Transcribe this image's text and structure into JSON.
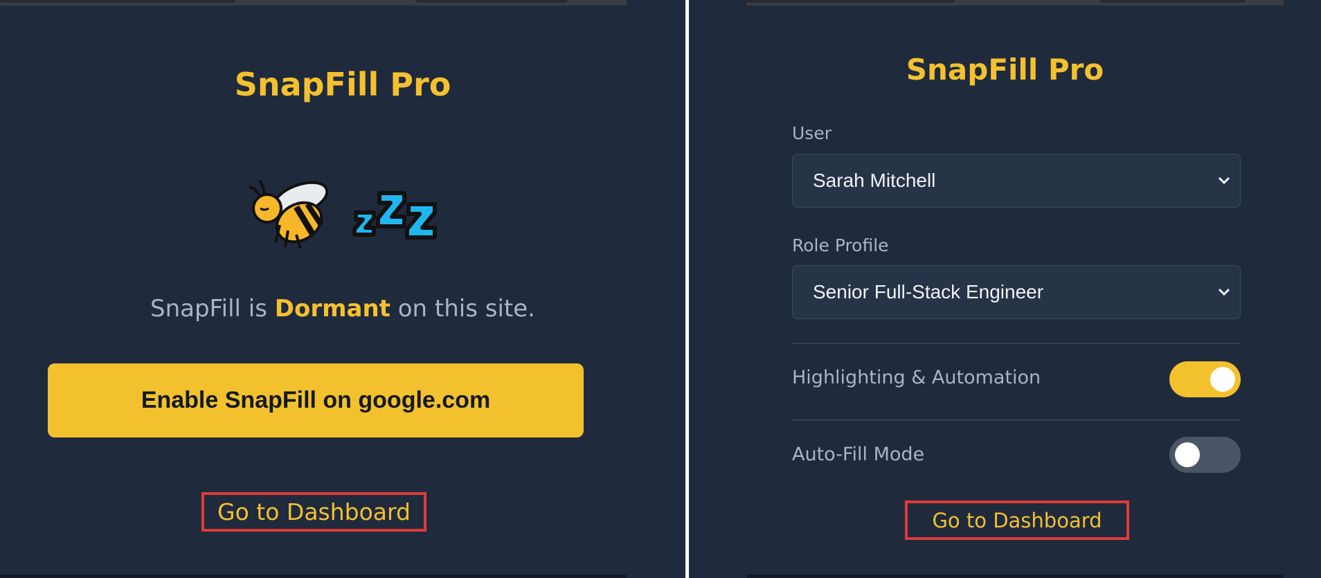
{
  "left_panel": {
    "title": "SnapFill Pro",
    "mascot_icon": "sleeping-bee",
    "status": {
      "prefix": "SnapFill is",
      "state": "Dormant",
      "suffix": "on this site."
    },
    "enable_button_label": "Enable SnapFill on google.com",
    "dashboard_link": "Go to Dashboard"
  },
  "right_panel": {
    "title": "SnapFill Pro",
    "user": {
      "label": "User",
      "value": "Sarah Mitchell"
    },
    "role_profile": {
      "label": "Role Profile",
      "value": "Senior Full-Stack Engineer"
    },
    "toggles": [
      {
        "label": "Highlighting & Automation",
        "on": true
      },
      {
        "label": "Auto-Fill Mode",
        "on": false
      }
    ],
    "dashboard_link": "Go to Dashboard"
  },
  "colors": {
    "background": "#1f2a3d",
    "accent": "#f4c12e",
    "muted_text": "#a9b4c6",
    "highlight_box": "#e03a3a"
  }
}
